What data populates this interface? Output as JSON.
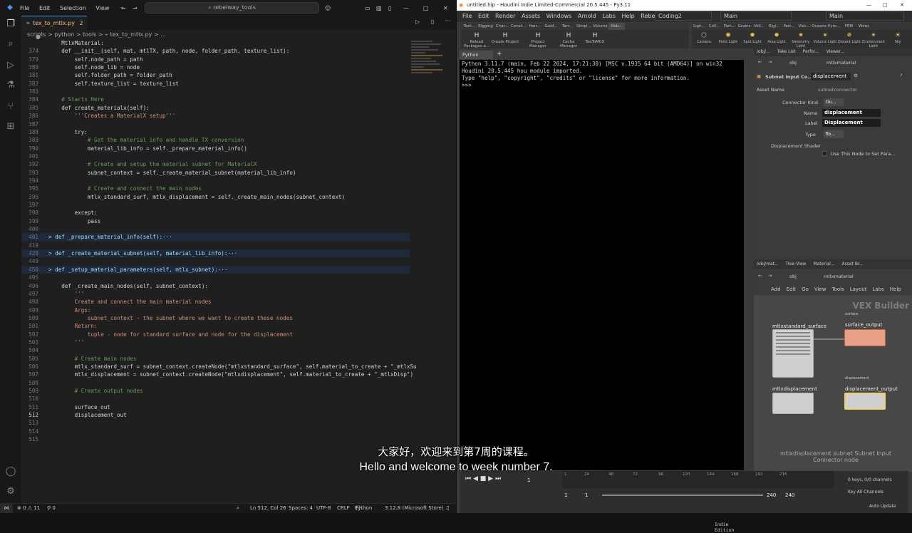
{
  "vscode": {
    "menu": [
      "File",
      "Edit",
      "Selection",
      "View"
    ],
    "search": "rebelway_tools",
    "tab": {
      "label": "tex_to_mtlx.py",
      "badge": "2"
    },
    "breadcrumb": "scripts > python > tools > ⌁ tex_to_mtlx.py > ...",
    "lines": [
      {
        "n": "374",
        "t": "    def __init__(self, mat, mtlTX, path, node, folder_path, texture_list):"
      },
      {
        "n": "379",
        "t": "        self.node_path = path"
      },
      {
        "n": "380",
        "t": "        self.node_lib = node"
      },
      {
        "n": "381",
        "t": "        self.folder_path = folder_path"
      },
      {
        "n": "382",
        "t": "        self.texture_list = texture_list"
      },
      {
        "n": "383",
        "t": ""
      },
      {
        "n": "384",
        "t": "    # Starts Here"
      },
      {
        "n": "385",
        "t": "    def create_materialx(self):"
      },
      {
        "n": "386",
        "t": "        '''Creates a MaterialX setup'''"
      },
      {
        "n": "387",
        "t": ""
      },
      {
        "n": "388",
        "t": "        try:"
      },
      {
        "n": "389",
        "t": "            # Get the material info and handle TX conversion"
      },
      {
        "n": "390",
        "t": "            material_lib_info = self._prepare_material_info()"
      },
      {
        "n": "391",
        "t": ""
      },
      {
        "n": "392",
        "t": "            # Create and setup the material subnet for MaterialX"
      },
      {
        "n": "393",
        "t": "            subnet_context = self._create_material_subnet(material_lib_info)"
      },
      {
        "n": "394",
        "t": ""
      },
      {
        "n": "395",
        "t": "            # Create and connect the main nodes"
      },
      {
        "n": "396",
        "t": "            mtlx_standard_surf, mtlx_displacement = self._create_main_nodes(subnet_context)"
      },
      {
        "n": "397",
        "t": ""
      },
      {
        "n": "398",
        "t": "        except:"
      },
      {
        "n": "399",
        "t": "            pass"
      },
      {
        "n": "400",
        "t": ""
      },
      {
        "n": "401",
        "t": "> def _prepare_material_info(self):···"
      },
      {
        "n": "419",
        "t": ""
      },
      {
        "n": "420",
        "t": "> def _create_material_subnet(self, material_lib_info):···"
      },
      {
        "n": "449",
        "t": ""
      },
      {
        "n": "450",
        "t": "> def _setup_material_parameters(self, mtlx_subnet):···"
      },
      {
        "n": "495",
        "t": ""
      },
      {
        "n": "496",
        "t": "    def _create_main_nodes(self, subnet_context):"
      },
      {
        "n": "497",
        "t": "        '''"
      },
      {
        "n": "498",
        "t": "        Create and connect the main material nodes"
      },
      {
        "n": "499",
        "t": "        Args:"
      },
      {
        "n": "500",
        "t": "            subnet_context - the subnet where we want to create these nodes"
      },
      {
        "n": "501",
        "t": "        Return:"
      },
      {
        "n": "502",
        "t": "            tuple - node for standard surface and node for the displacement"
      },
      {
        "n": "503",
        "t": "        '''"
      },
      {
        "n": "504",
        "t": ""
      },
      {
        "n": "505",
        "t": "        # Create main nodes"
      },
      {
        "n": "506",
        "t": "        mtlx_standard_surf = subnet_context.createNode(\"mtlxstandard_surface\", self.material_to_create + \"_mtlxSu"
      },
      {
        "n": "507",
        "t": "        mtlx_displacement = subnet_context.createNode(\"mtlxdisplacement\", self.material_to_create + \"_mtlxDisp\")"
      },
      {
        "n": "508",
        "t": ""
      },
      {
        "n": "509",
        "t": "        # Create output nodes"
      },
      {
        "n": "510",
        "t": ""
      },
      {
        "n": "511",
        "t": "        surface_out"
      },
      {
        "n": "512",
        "t": "        displacement_out"
      },
      {
        "n": "513",
        "t": ""
      },
      {
        "n": "514",
        "t": ""
      },
      {
        "n": "515",
        "t": ""
      }
    ],
    "sticky": "    MtlxMaterial:",
    "status": {
      "errors": "⊗ 0 ⚠ 11",
      "ports": "⚲ 0",
      "position": "Ln 512, Col 26",
      "spaces": "Spaces: 4",
      "encoding": "UTF-8",
      "eol": "CRLF",
      "lang": "Python",
      "interp": "3.12.8 (Microsoft Store)"
    }
  },
  "houdini": {
    "title": "untitled.hip - Houdini Indie Limited-Commercial 20.5.445 - Py3.11",
    "menu": [
      "File",
      "Edit",
      "Render",
      "Assets",
      "Windows",
      "Arnold",
      "Labs",
      "Help",
      "Rebelway Tools"
    ],
    "desktop": "Coding2",
    "main_select": "Main",
    "main_select2": "Main",
    "shelf_tabs": [
      "Text...",
      "Rigging",
      "Char...",
      "Const...",
      "Hair...",
      "Guid...",
      "Terr...",
      "Simpl...",
      "Volume",
      "Reb..."
    ],
    "tools": [
      "Reload Packages a...",
      "Create Project",
      "Project Manager",
      "Cache Manager",
      "TexToMtlX"
    ],
    "shelf_tabs2": [
      "Ligh...",
      "Coll...",
      "Part...",
      "Grains",
      "Vell...",
      "Rigi...",
      "Part...",
      "Visc...",
      "Oceans",
      "Pyro...",
      "FEM",
      "Wires"
    ],
    "tools2": [
      "Camera",
      "Point Light",
      "Spot Light",
      "Area Light",
      "Geometry Light",
      "Volume Light",
      "Distant Light",
      "Environment Light",
      "Sky"
    ],
    "pyshell_tab": "Python Shell",
    "shell_lines": [
      "Python 3.11.7 (main, Feb 22 2024, 17:21:30) [MSC v.1935 64 bit (AMD64)] on win32",
      "Houdini 20.5.445 hou module imported.",
      "Type \"help\", \"copyright\", \"credits\" or \"license\" for more information.",
      ">>>"
    ],
    "indie": "Indie Edition",
    "param": {
      "tabs": [
        "/obj/...",
        "Take List",
        "Perfor...",
        "Viewer..."
      ],
      "path_obj": "obj",
      "path_node": "mtlxmaterial",
      "node_type": "Subnet Input Co...",
      "node_name": "displacement",
      "asset_name_label": "Asset Name",
      "asset_name_value": "subnetconnector",
      "connector_kind_label": "Connector Kind",
      "connector_kind_value": "Ou...",
      "name_label": "Name",
      "name_value": "displacement",
      "label_label": "Label",
      "label_value": "Displacement",
      "type_label": "Type",
      "type_value": "flo...",
      "disp_shader_label": "Displacement Shader",
      "use_node_label": "Use This Node to Set Para..."
    },
    "net": {
      "tabs": [
        "/obj/mat...",
        "Tree View",
        "Material...",
        "Asset Br..."
      ],
      "path_obj": "obj",
      "path_node": "mtlxmaterial",
      "menu": [
        "Add",
        "Edit",
        "Go",
        "View",
        "Tools",
        "Layout",
        "Labs",
        "Help"
      ],
      "vex_builder": "VEX Builder",
      "nodes": {
        "surf": "mtlxstandard_surface",
        "surf_out_tag": "surface",
        "surf_out": "surface_output",
        "disp": "mtlxdisplacement",
        "disp_out_tag": "displacement",
        "disp_out": "displacement_output"
      },
      "help_text": "mtlxdisplacement   subnet Subnet Input Connector node"
    },
    "timeline": {
      "ticks": [
        "1",
        "24",
        "48",
        "72",
        "96",
        "120",
        "144",
        "168",
        "192",
        "216"
      ],
      "frame": "1",
      "start": "1",
      "start2": "1",
      "end": "240",
      "end2": "240",
      "keys": "0 keys, 0/0 channels",
      "key_all": "Key All Channels",
      "auto_update": "Auto Update"
    }
  },
  "subtitles": {
    "cn": "大家好，欢迎来到第7周的课程。",
    "en": "Hello and welcome to week number 7."
  }
}
